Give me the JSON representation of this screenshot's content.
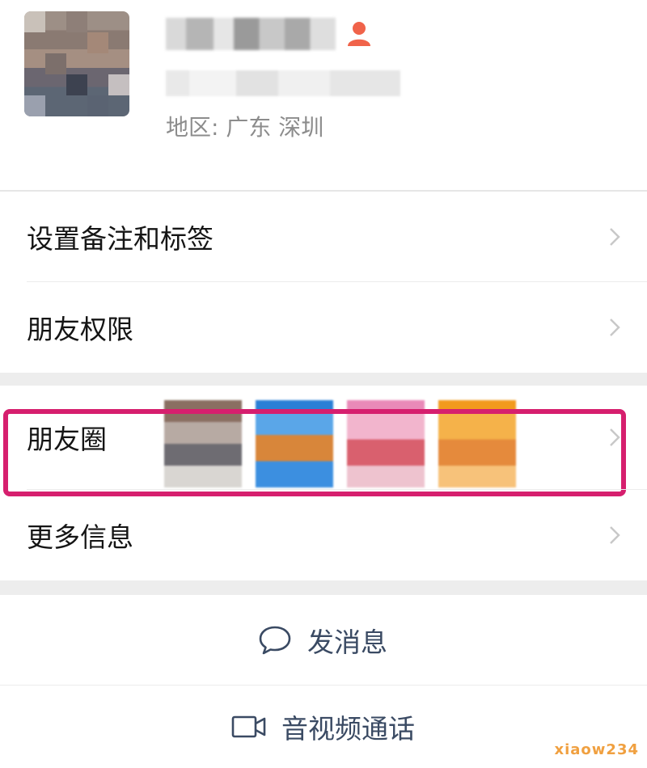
{
  "profile": {
    "region": "地区: 广东 深圳"
  },
  "menu": {
    "remark_tags": "设置备注和标签",
    "friend_permission": "朋友权限",
    "moments": "朋友圈",
    "more_info": "更多信息"
  },
  "actions": {
    "send_message": "发消息",
    "video_call": "音视频通话"
  },
  "watermark": "xiaow234",
  "colors": {
    "highlight_border": "#d61f6e",
    "action_text": "#3a4a63",
    "region_text": "#8c8c8c",
    "gap_background": "#ededed"
  }
}
